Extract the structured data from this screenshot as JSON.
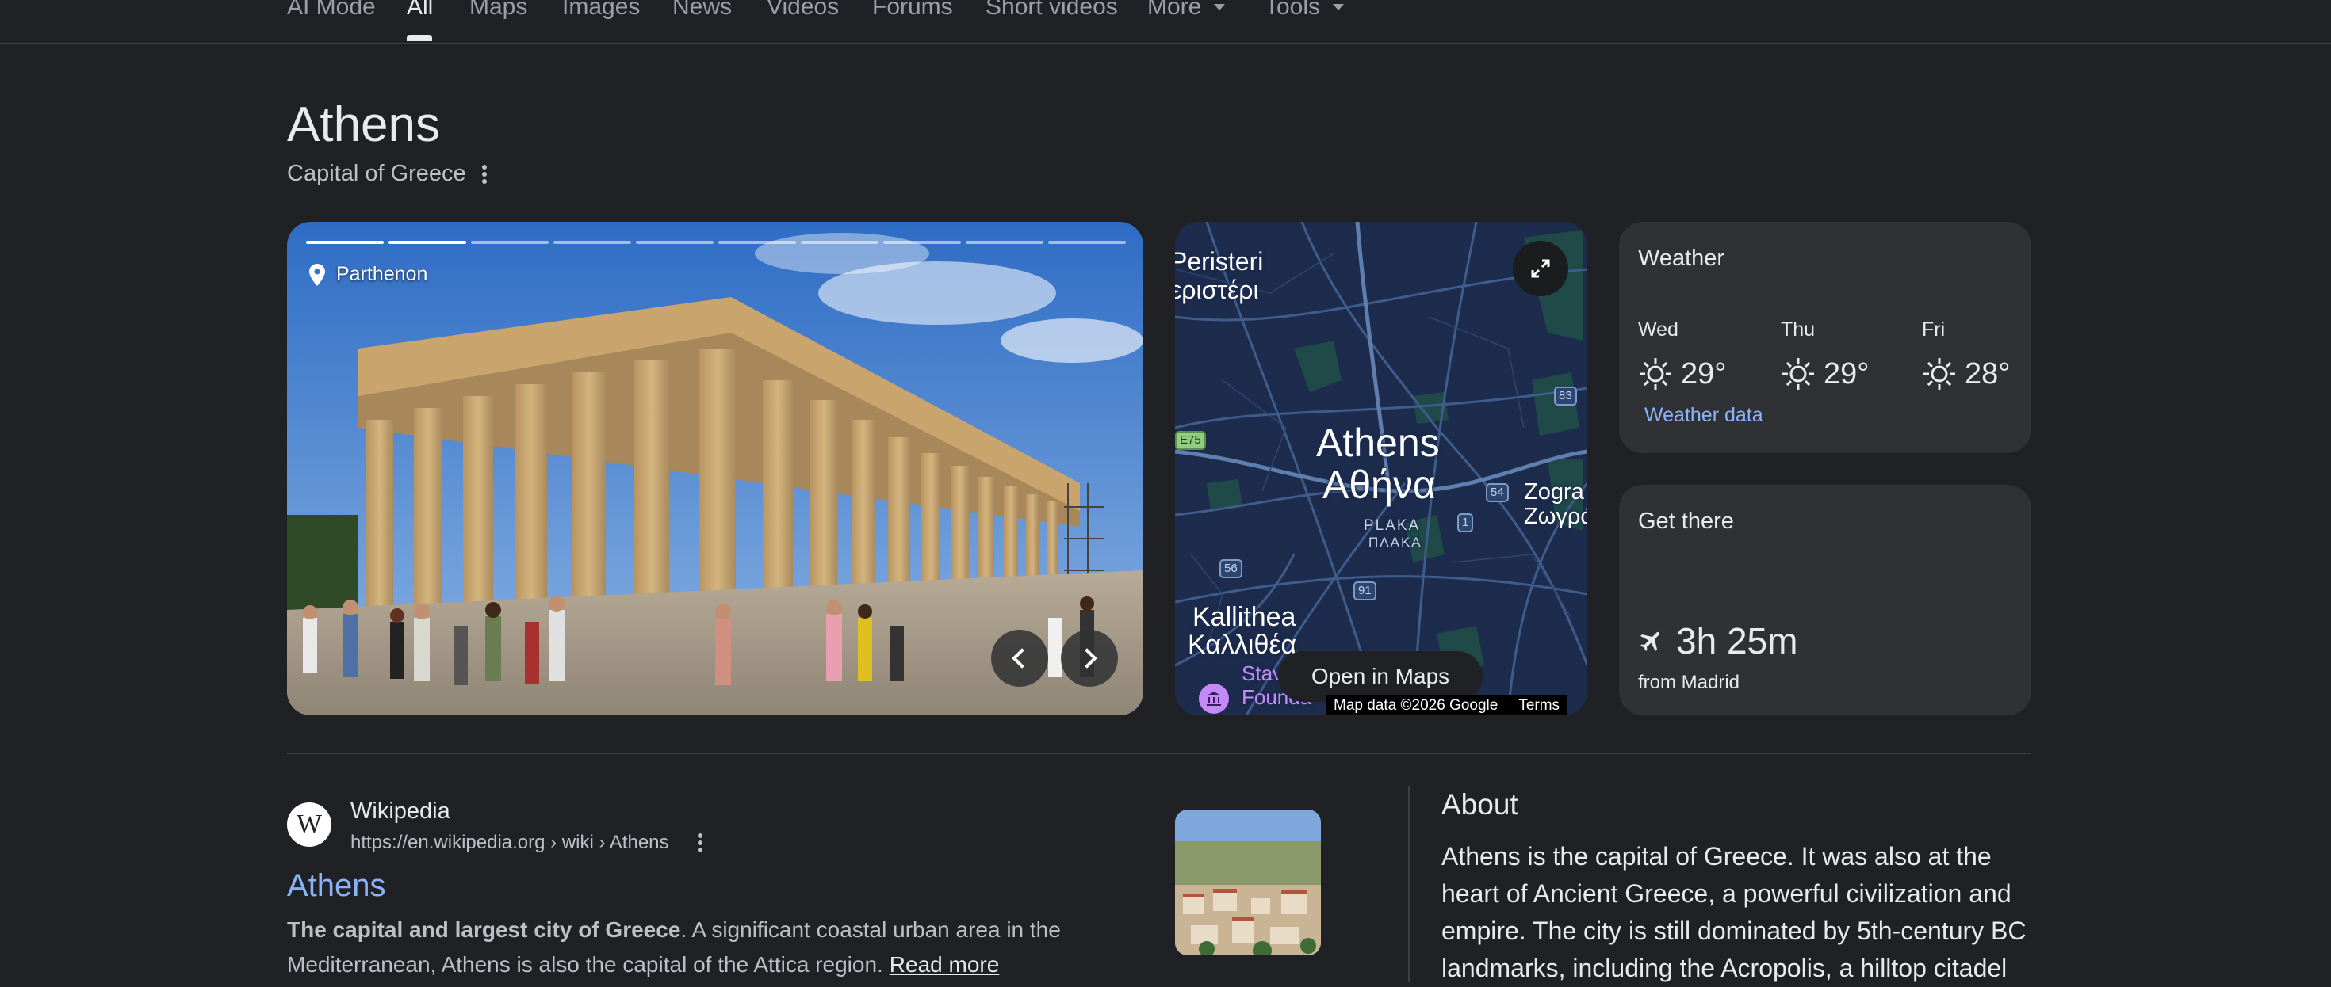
{
  "tabs": {
    "ai_mode": "AI Mode",
    "all": "All",
    "maps": "Maps",
    "images": "Images",
    "news": "News",
    "videos": "Videos",
    "forums": "Forums",
    "short_videos": "Short videos",
    "more": "More",
    "tools": "Tools"
  },
  "entity": {
    "title": "Athens",
    "subtitle": "Capital of Greece"
  },
  "photo": {
    "place": "Parthenon",
    "slides_total": 10,
    "slide_current": 3
  },
  "map": {
    "city_en": "Athens",
    "city_gr": "Αθήνα",
    "district_en": "PLAKA",
    "district_gr": "ΠΛΑΚΑ",
    "peristeri_en": "Peristeri",
    "peristeri_gr": "εριστέρι",
    "kallithea_en": "Kallithea",
    "kallithea_gr": "Καλλιθέα",
    "zografou_en": "Zogra",
    "zografou_gr": "Ζωγρά",
    "poi": "Stav",
    "poi2": "Founda",
    "roads": [
      "E75",
      "83",
      "54",
      "1",
      "56",
      "91"
    ],
    "open_maps": "Open in Maps",
    "attribution": "Map data ©2026 Google",
    "terms": "Terms"
  },
  "weather": {
    "title": "Weather",
    "days": [
      {
        "day": "Wed",
        "temp": "29°"
      },
      {
        "day": "Thu",
        "temp": "29°"
      },
      {
        "day": "Fri",
        "temp": "28°"
      }
    ],
    "link": "Weather data",
    "icon": "sun-icon"
  },
  "get_there": {
    "title": "Get there",
    "duration": "3h 25m",
    "from": "from Madrid",
    "icon": "airplane-icon"
  },
  "wiki": {
    "source": "Wikipedia",
    "url": "https://en.wikipedia.org › wiki › Athens",
    "title": "Athens",
    "snippet_bold": "The capital and largest city of Greece",
    "snippet_rest": ". A significant coastal urban area in the Mediterranean, Athens is also the capital of the Attica region.",
    "read_more": "Read more"
  },
  "about": {
    "title": "About",
    "text": "Athens is the capital of Greece. It was also at the heart of Ancient Greece, a powerful civilization and empire. The city is still dominated by 5th-century BC landmarks, including the Acropolis, a hilltop citadel"
  },
  "colors": {
    "background": "#202124",
    "card": "#303134",
    "link": "#8ab4f8",
    "map_bg": "#1d2c4d"
  }
}
